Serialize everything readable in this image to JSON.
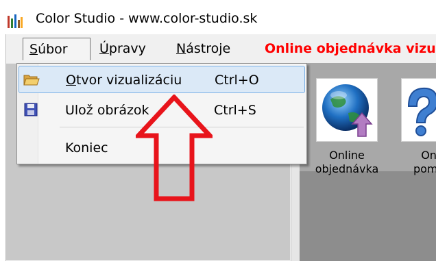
{
  "window": {
    "title": "Color Studio - www.color-studio.sk"
  },
  "menubar": {
    "subor_u": "S",
    "subor_rest": "úbor",
    "upravy_u": "Ú",
    "upravy_rest": "pravy",
    "nastroje_u": "N",
    "nastroje_rest": "ástroje",
    "online": "Online objednávka vizu"
  },
  "file_menu": {
    "open": {
      "u": "O",
      "rest": "tvor vizualizáciu",
      "shortcut": "Ctrl+O"
    },
    "save": {
      "label": "Ulož obrázok",
      "shortcut": "Ctrl+S"
    },
    "exit": {
      "label": "Koniec"
    }
  },
  "toolbar": {
    "online_line1": "Online",
    "online_line2": "objednávka",
    "help_line1": "Onli",
    "help_line2": "pomoc"
  },
  "colors": {
    "accent_red": "#ff0000",
    "arrow_red": "#e8141b",
    "hover_fill": "#dbe9f7",
    "hover_border": "#7ab0e6"
  },
  "icons": {
    "app": "app-logo-icon",
    "open": "folder-open-icon",
    "save": "floppy-disk-icon",
    "online": "globe-upload-icon",
    "help": "help-question-icon"
  }
}
